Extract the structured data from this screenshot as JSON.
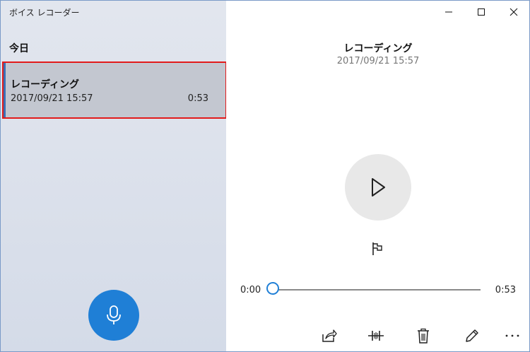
{
  "app": {
    "title": "ボイス レコーダー"
  },
  "window_controls": {
    "minimize": "minimize",
    "maximize": "maximize",
    "close": "close"
  },
  "sidebar": {
    "section_label": "今日",
    "recordings": [
      {
        "title": "レコーディング",
        "date": "2017/09/21 15:57",
        "duration": "0:53"
      }
    ],
    "record_button_icon": "microphone-icon"
  },
  "detail": {
    "title": "レコーディング",
    "date": "2017/09/21 15:57",
    "play_icon": "play-icon",
    "flag_icon": "flag-icon",
    "playback": {
      "current_time": "0:00",
      "total_time": "0:53",
      "progress": 0
    },
    "toolbar": [
      "share-icon",
      "trim-icon",
      "delete-icon",
      "rename-icon",
      "more-icon"
    ]
  },
  "colors": {
    "accent": "#1f7fd6",
    "highlight_border": "#e21b1b",
    "selected_item_bg": "#c3c7d0",
    "sidebar_bg": "#dde2ec"
  }
}
